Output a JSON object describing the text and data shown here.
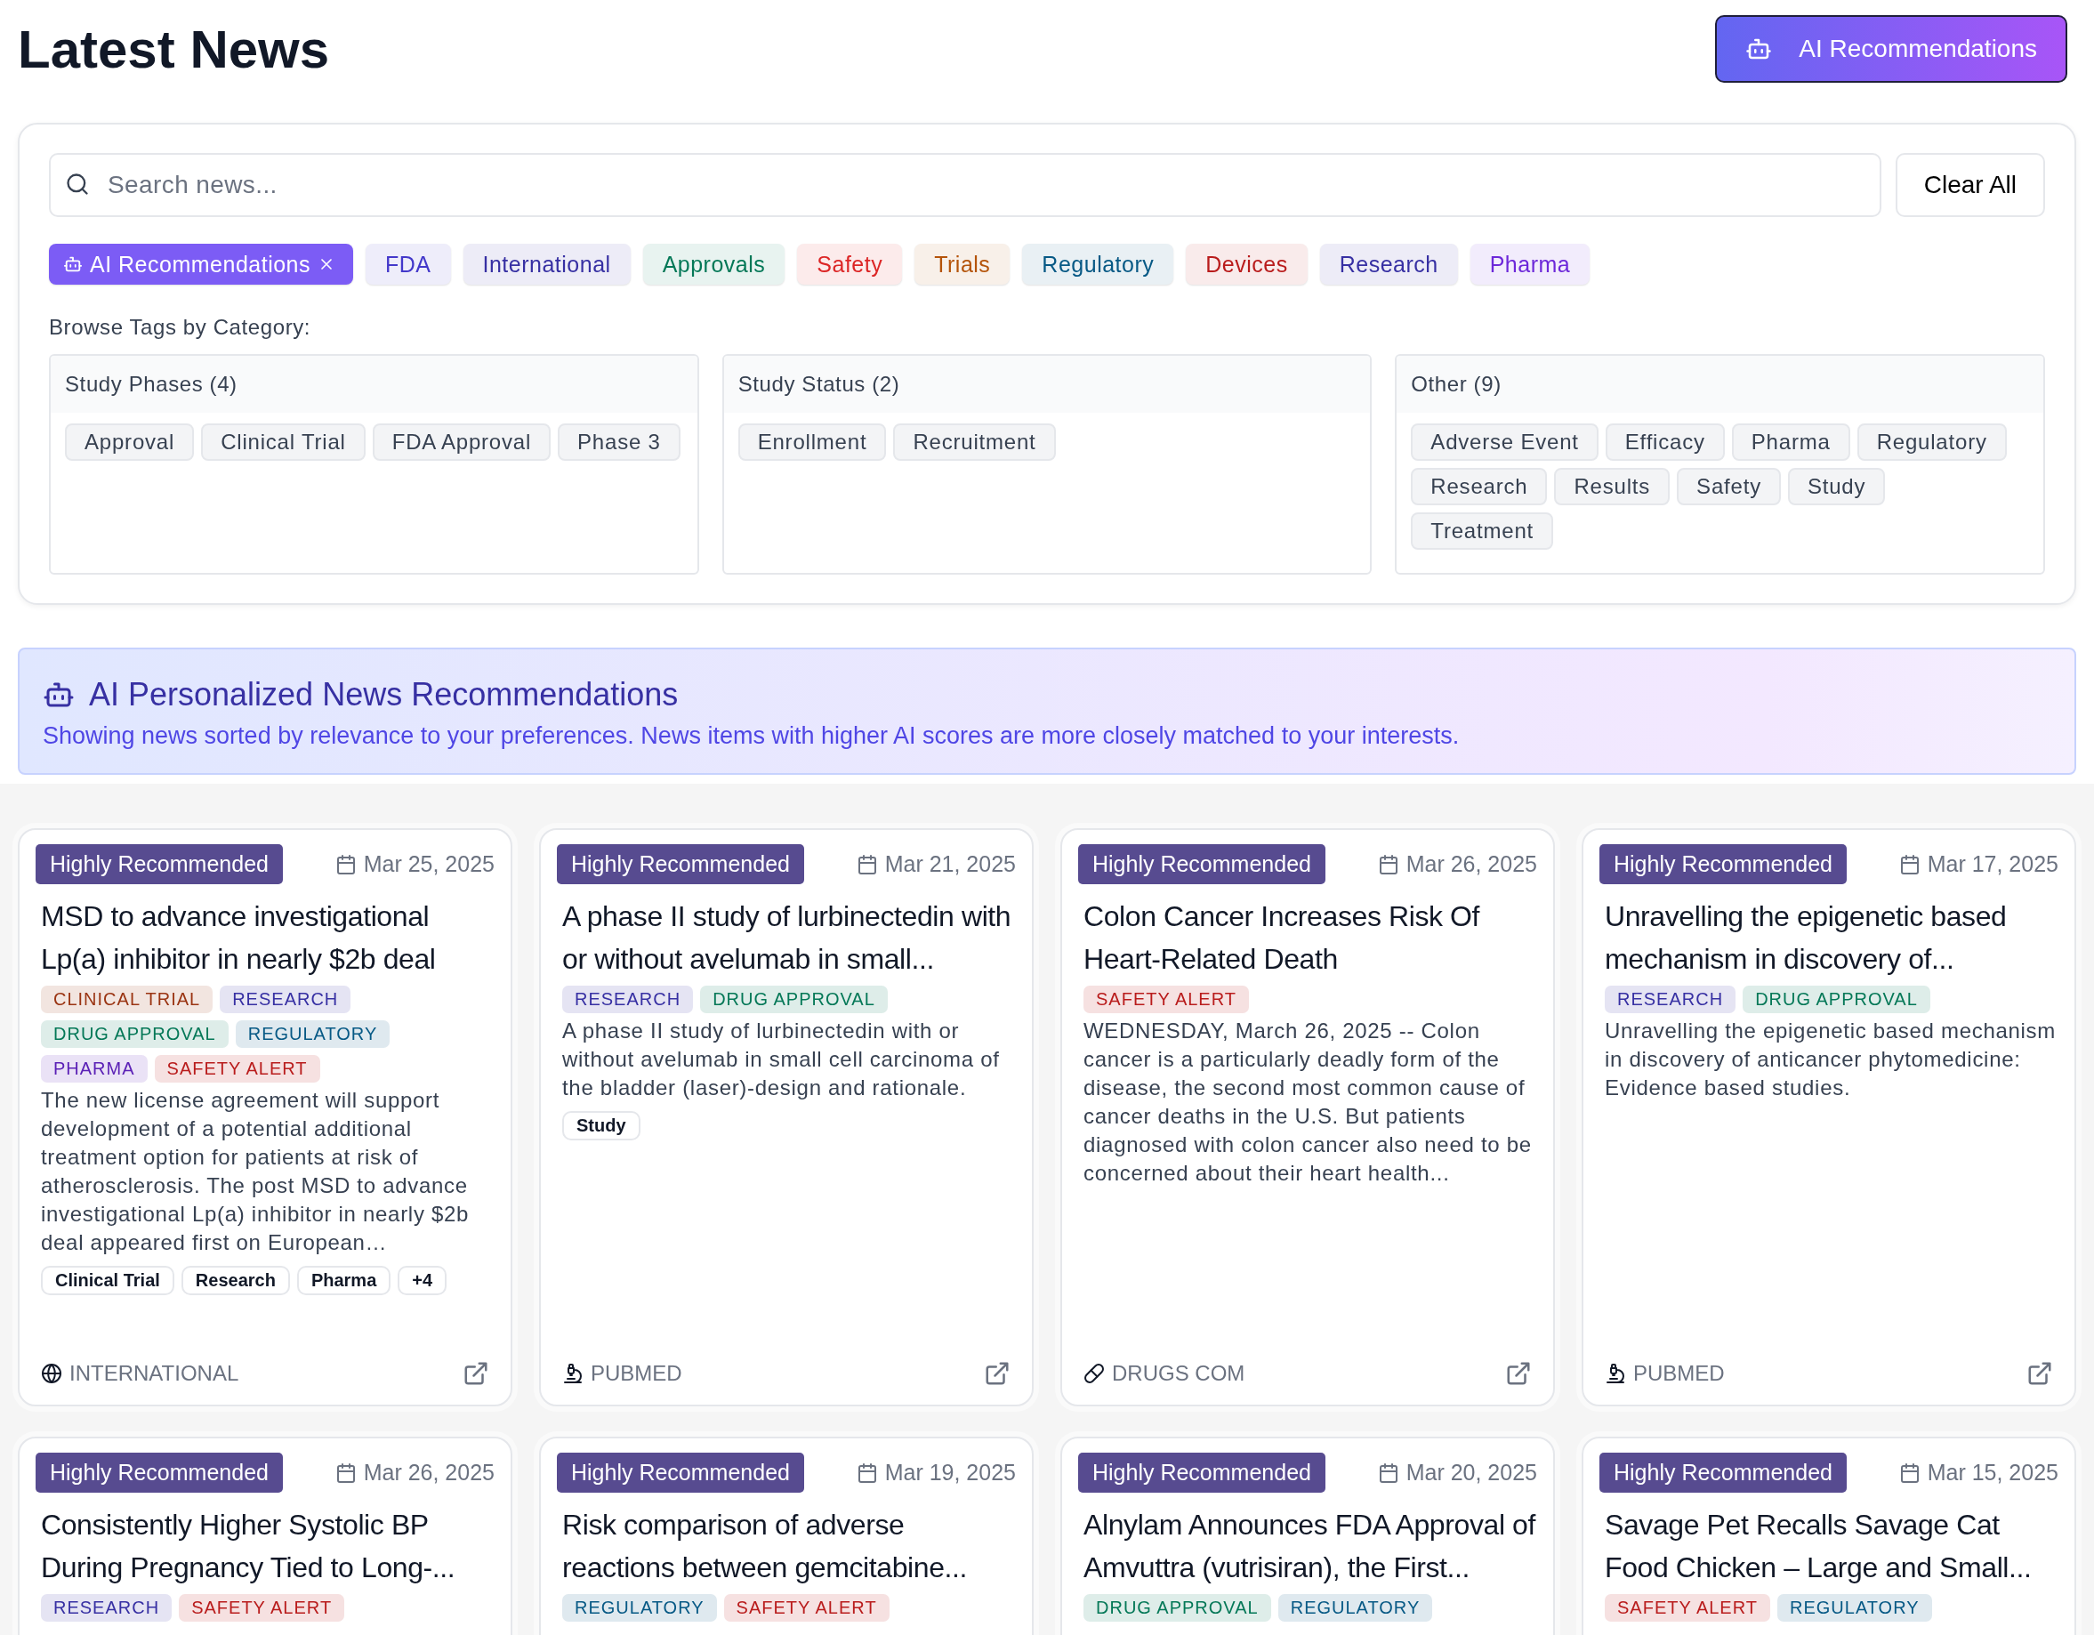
{
  "header": {
    "title": "Latest News",
    "ai_button": "AI Recommendations"
  },
  "filters": {
    "search": {
      "placeholder": "Search news..."
    },
    "clear_button": "Clear All",
    "chips": [
      {
        "label": "AI Recommendations",
        "kind": "ai",
        "selected": true,
        "color": "#7c5cf5"
      },
      {
        "label": "FDA",
        "kind": "plain",
        "selected": false,
        "color": "#4338ca"
      },
      {
        "label": "International",
        "kind": "plain",
        "selected": false,
        "color": "#3730a3"
      },
      {
        "label": "Approvals",
        "kind": "plain",
        "selected": false,
        "color": "#047857"
      },
      {
        "label": "Safety",
        "kind": "plain",
        "selected": false,
        "color": "#dc2626"
      },
      {
        "label": "Trials",
        "kind": "plain",
        "selected": false,
        "color": "#b45309"
      },
      {
        "label": "Regulatory",
        "kind": "plain",
        "selected": false,
        "color": "#075985"
      },
      {
        "label": "Devices",
        "kind": "plain",
        "selected": false,
        "color": "#b91c1c"
      },
      {
        "label": "Research",
        "kind": "plain",
        "selected": false,
        "color": "#3730a3"
      },
      {
        "label": "Pharma",
        "kind": "plain",
        "selected": false,
        "color": "#6d28d9"
      }
    ],
    "browse_label": "Browse Tags by Category:",
    "categories": [
      {
        "title": "Study Phases (4)",
        "tags": [
          "Approval",
          "Clinical Trial",
          "FDA Approval",
          "Phase 3"
        ]
      },
      {
        "title": "Study Status (2)",
        "tags": [
          "Enrollment",
          "Recruitment"
        ]
      },
      {
        "title": "Other (9)",
        "tags": [
          "Adverse Event",
          "Efficacy",
          "Pharma",
          "Regulatory",
          "Research",
          "Results",
          "Safety",
          "Study",
          "Treatment"
        ]
      }
    ]
  },
  "ai_banner": {
    "title": "AI Personalized News Recommendations",
    "text": "Showing news sorted by relevance to your preferences. News items with higher AI scores are more closely matched to your interests."
  },
  "articles": [
    {
      "badge": "Highly Recommended",
      "date": "Mar 25, 2025",
      "title": "MSD to advance investigational Lp(a) inhibitor in nearly $2b deal",
      "tags": [
        {
          "label": "CLINICAL TRIAL",
          "color": "#9a3412"
        },
        {
          "label": "RESEARCH",
          "color": "#3730a3"
        },
        {
          "label": "DRUG APPROVAL",
          "color": "#047857"
        },
        {
          "label": "REGULATORY",
          "color": "#075985"
        },
        {
          "label": "PHARMA",
          "color": "#5b21b6"
        },
        {
          "label": "SAFETY ALERT",
          "color": "#b91c1c"
        }
      ],
      "summary": "The new license agreement will support development of a potential additional treatment option for patients at risk of atherosclerosis. The post MSD to advance investigational Lp(a) inhibitor in nearly $2b deal appeared first on European…",
      "keywords": [
        "Clinical Trial",
        "Research",
        "Pharma",
        "+4"
      ],
      "source": "INTERNATIONAL",
      "kind": "globe"
    },
    {
      "badge": "Highly Recommended",
      "date": "Mar 21, 2025",
      "title": "A phase II study of lurbinectedin with or without avelumab in small...",
      "tags": [
        {
          "label": "RESEARCH",
          "color": "#3730a3"
        },
        {
          "label": "DRUG APPROVAL",
          "color": "#047857"
        }
      ],
      "summary": "A phase II study of lurbinectedin with or without avelumab in small cell carcinoma of the bladder (laser)-design and rationale.",
      "keywords": [
        "Study"
      ],
      "source": "PUBMED",
      "kind": "microscope"
    },
    {
      "badge": "Highly Recommended",
      "date": "Mar 26, 2025",
      "title": "Colon Cancer Increases Risk Of Heart-Related Death",
      "tags": [
        {
          "label": "SAFETY ALERT",
          "color": "#b91c1c"
        }
      ],
      "summary": "WEDNESDAY, March 26, 2025 -- Colon cancer is a particularly deadly form of the disease, the second most common cause of cancer deaths in the U.S. But patients diagnosed with colon cancer also need to be concerned about their heart health...",
      "source": "DRUGS COM",
      "kind": "pill"
    },
    {
      "badge": "Highly Recommended",
      "date": "Mar 17, 2025",
      "title": "Unravelling the epigenetic based mechanism in discovery of...",
      "tags": [
        {
          "label": "RESEARCH",
          "color": "#3730a3"
        },
        {
          "label": "DRUG APPROVAL",
          "color": "#047857"
        }
      ],
      "summary": "Unravelling the epigenetic based mechanism in discovery of anticancer phytomedicine: Evidence based studies.",
      "source": "PUBMED",
      "kind": "microscope"
    },
    {
      "badge": "Highly Recommended",
      "date": "Mar 26, 2025",
      "title": "Consistently Higher Systolic BP During Pregnancy Tied to Long-...",
      "tags": [
        {
          "label": "RESEARCH",
          "color": "#3730a3"
        },
        {
          "label": "SAFETY ALERT",
          "color": "#b91c1c"
        }
      ]
    },
    {
      "badge": "Highly Recommended",
      "date": "Mar 19, 2025",
      "title": "Risk comparison of adverse reactions between gemcitabine...",
      "tags": [
        {
          "label": "REGULATORY",
          "color": "#075985"
        },
        {
          "label": "SAFETY ALERT",
          "color": "#b91c1c"
        }
      ]
    },
    {
      "badge": "Highly Recommended",
      "date": "Mar 20, 2025",
      "title": "Alnylam Announces FDA Approval of Amvuttra (vutrisiran), the First...",
      "tags": [
        {
          "label": "DRUG APPROVAL",
          "color": "#047857"
        },
        {
          "label": "REGULATORY",
          "color": "#075985"
        }
      ]
    },
    {
      "badge": "Highly Recommended",
      "date": "Mar 15, 2025",
      "title": "Savage Pet Recalls Savage Cat Food Chicken – Large and Small...",
      "tags": [
        {
          "label": "SAFETY ALERT",
          "color": "#b91c1c"
        },
        {
          "label": "REGULATORY",
          "color": "#075985"
        }
      ]
    }
  ]
}
